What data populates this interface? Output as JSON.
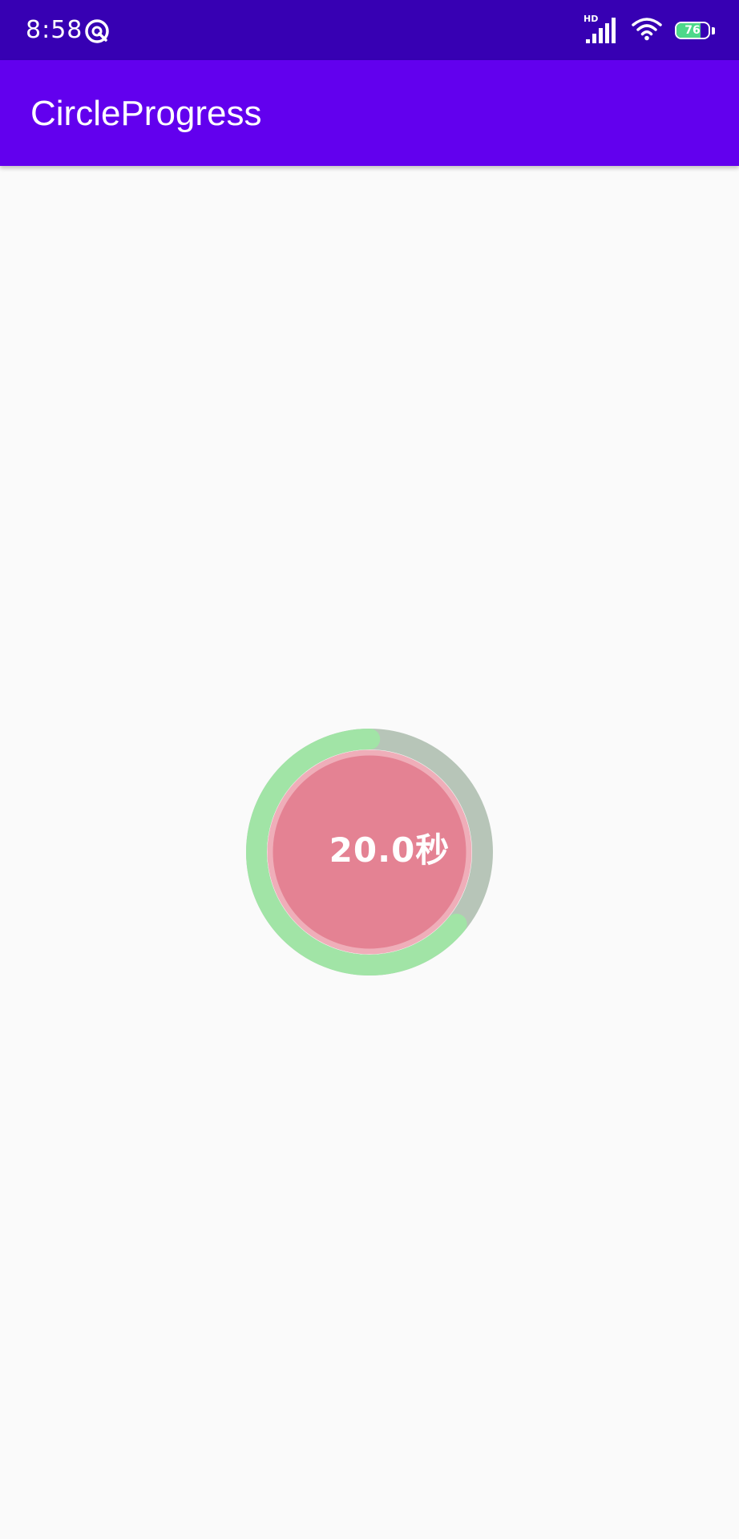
{
  "status_bar": {
    "time": "8:58",
    "network_label": "HD",
    "battery_level": "76",
    "battery_fraction": 0.76
  },
  "app_bar": {
    "title": "CircleProgress"
  },
  "circle_progress": {
    "value_text": "20.0秒",
    "progress_fraction": 0.64,
    "colors": {
      "progress": "#a1e4a6",
      "track": "#b7c5b8",
      "inner_border": "#efaeb9",
      "inner_fill": "#e48293",
      "text": "#ffffff"
    }
  },
  "colors": {
    "status_bar": "#3700b3",
    "app_bar": "#6200ee",
    "background": "#fafafa"
  },
  "icons": {
    "status_app": "vpn-key-icon",
    "signal": "cellular-signal-icon",
    "wifi": "wifi-icon",
    "battery": "battery-icon"
  }
}
